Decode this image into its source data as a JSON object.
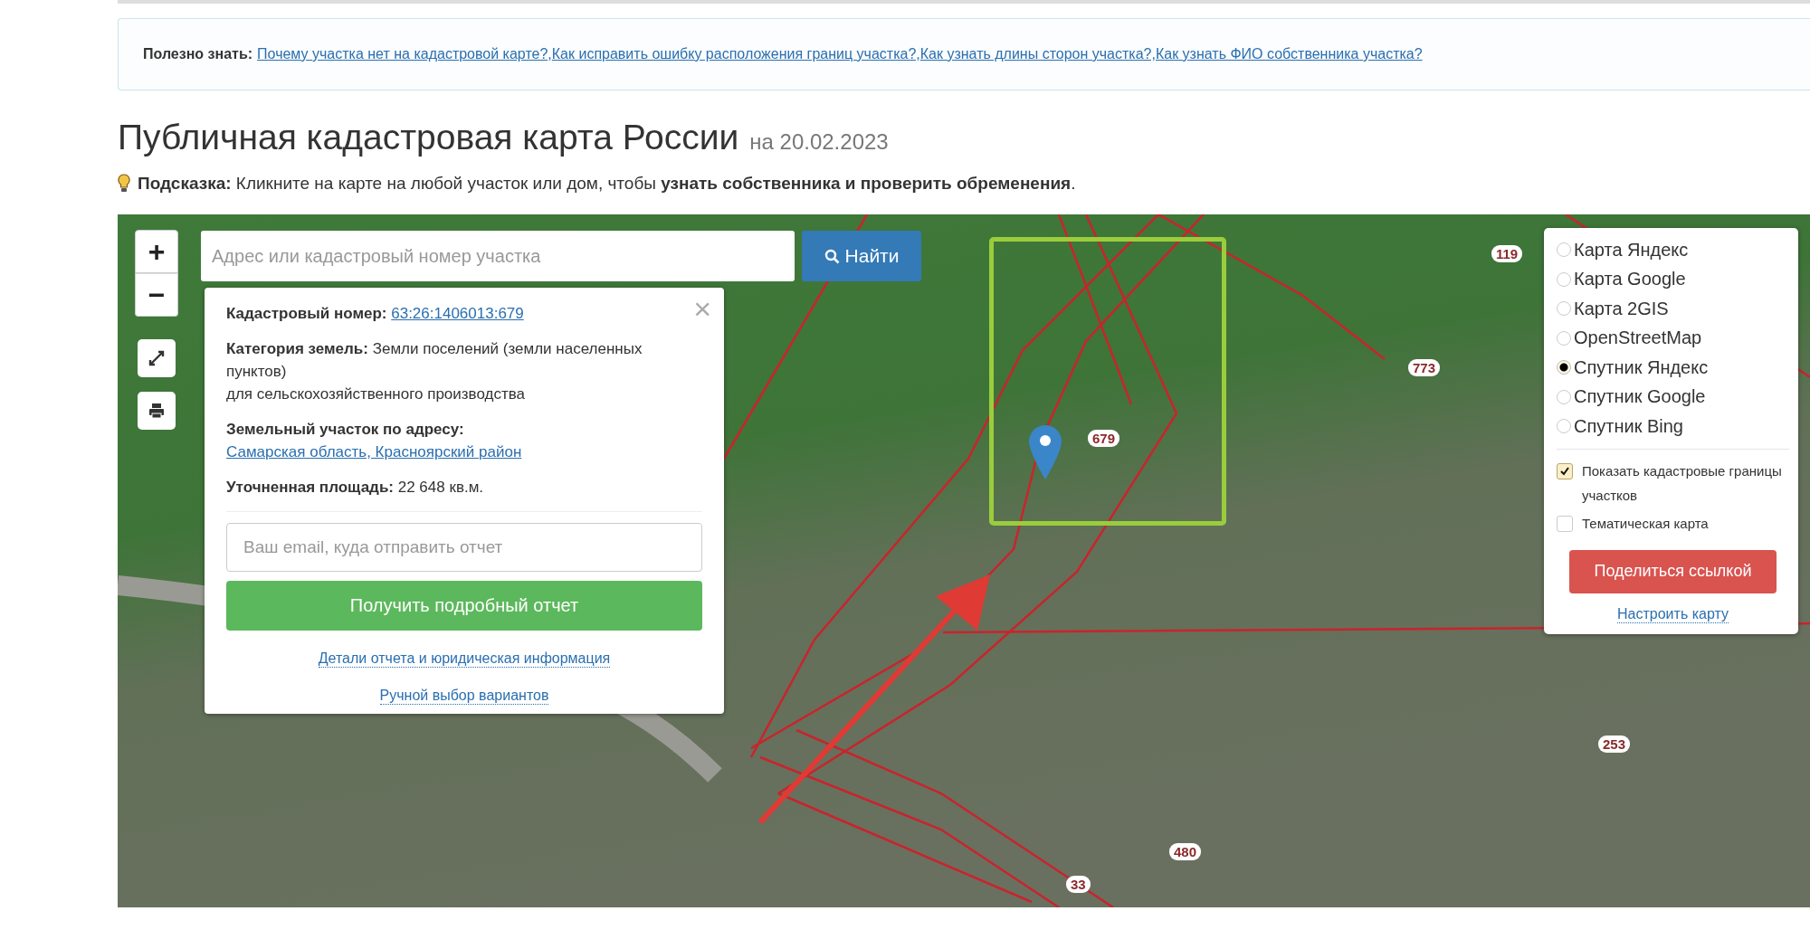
{
  "useful": {
    "label": "Полезно знать:",
    "links": [
      "Почему участка нет на кадастровой карте?,",
      "Как исправить ошибку расположения границ участка?,",
      "Как узнать длины сторон участка?,",
      "Как узнать ФИО собственника участка?"
    ]
  },
  "title": "Публичная кадастровая карта России",
  "date": "на 20.02.2023",
  "hint": "**Подсказка:** Кликните на карте на любой участок или дом, чтобы **узнать собственника и проверить обременения**.",
  "map": {
    "zoom_in": "+",
    "zoom_out": "−",
    "search": {
      "placeholder": "Адрес или кадастровый номер участка",
      "button": "Найти"
    },
    "popup": {
      "close": "×",
      "cadastral": {
        "label": "Кадастровый номер:",
        "value": "63:26:1406013:679"
      },
      "category": {
        "label": "Категория земель:",
        "value": "Земли поселений (земли населенных пунктов)",
        "detail": "для сельскохозяйственного производства"
      },
      "address": {
        "label": "Земельный участок по адресу:",
        "value": "Самарская область, Красноярский район"
      },
      "area": {
        "label": "Уточненная площадь:",
        "value": "22 648 кв.м."
      },
      "email": {
        "placeholder": "Ваш email, куда отправить отчет"
      },
      "report_button": "Получить подробный отчет",
      "links": [
        "Детали отчета и юридическая информация",
        "Ручной выбор вариантов"
      ]
    },
    "layers": [
      {
        "label": "Карта Яндекс",
        "selected": false
      },
      {
        "label": "Карта Google",
        "selected": false
      },
      {
        "label": "Карта 2GIS",
        "selected": false
      },
      {
        "label": "OpenStreetMap",
        "selected": false
      },
      {
        "label": "Спутник Яндекс",
        "selected": true
      },
      {
        "label": "Спутник Google",
        "selected": false
      },
      {
        "label": "Спутник Bing",
        "selected": false
      }
    ],
    "options": [
      {
        "label": "Показать кадастровые границы участков",
        "checked": true
      },
      {
        "label": "Тематическая карта",
        "checked": false
      }
    ],
    "share_button": "Поделиться ссылкой",
    "settings_link": "Настроить карту",
    "parcel_labels": [
      "679",
      "773",
      "253",
      "480",
      "33",
      "119"
    ]
  }
}
